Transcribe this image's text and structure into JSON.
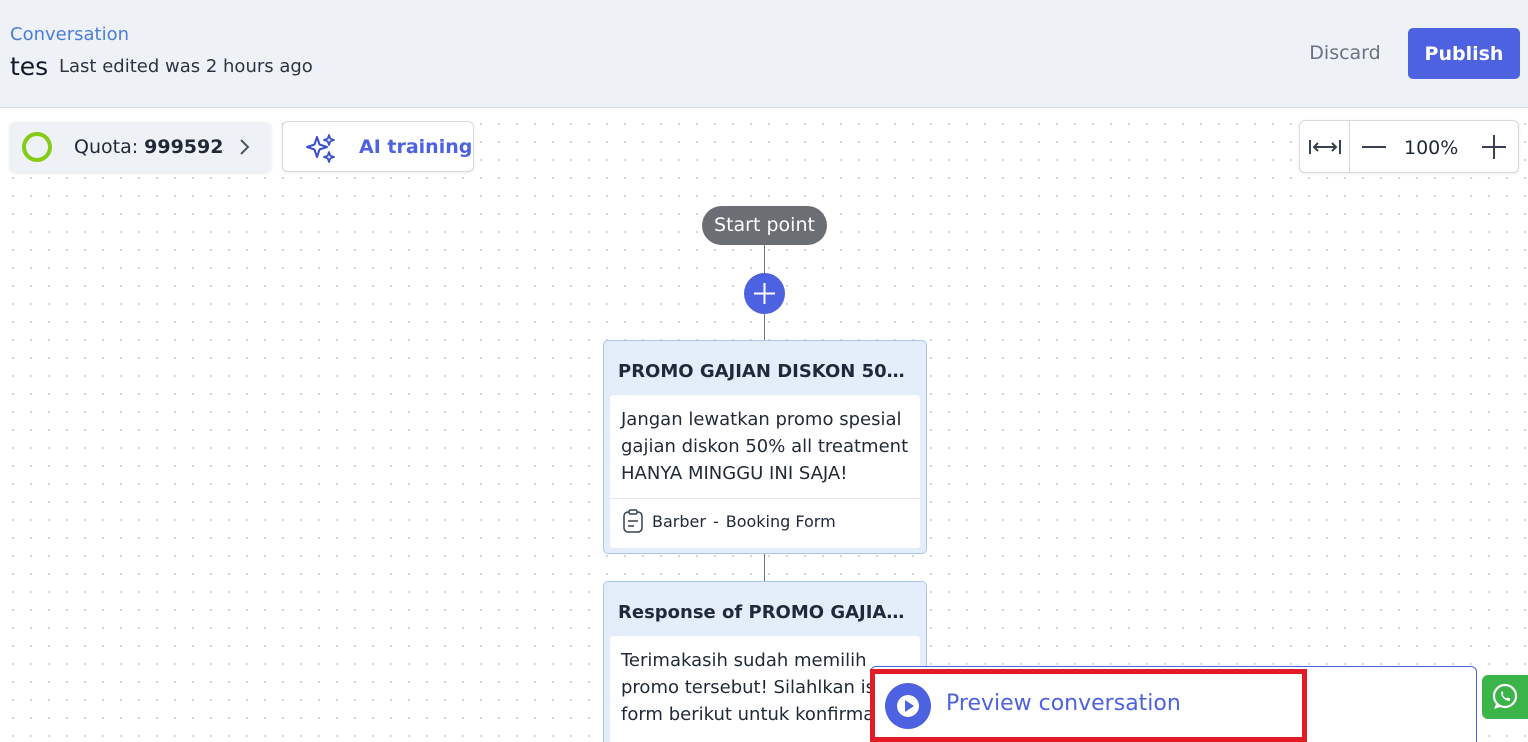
{
  "header": {
    "breadcrumb": "Conversation",
    "flow_name": "tes",
    "last_edited": "Last edited was 2 hours ago",
    "discard_label": "Discard",
    "publish_label": "Publish",
    "accent_color": "#4d62e0"
  },
  "toolbar": {
    "quota_label": "Quota:",
    "quota_value": "999592",
    "ai_training_label": "AI training",
    "zoom_level": "100%"
  },
  "flow": {
    "start_label": "Start point",
    "nodes": [
      {
        "title": "PROMO GAJIAN DISKON 50%...",
        "text_lines": [
          "Jangan lewatkan promo spesial",
          "gajian diskon 50% all treatment",
          "HANYA MINGGU INI SAJA!"
        ],
        "form_name": "Barber",
        "form_separator": "-",
        "form_type": "Booking Form"
      },
      {
        "title": "Response of PROMO GAJIAN ...",
        "text_lines": [
          "Terimakasih sudah memilih",
          "promo tersebut! Silahlkan isi",
          "form berikut untuk konfirmasi"
        ]
      }
    ]
  },
  "preview": {
    "label": "Preview conversation"
  },
  "icons": {
    "quota": "quota-ring-icon",
    "ai": "sparkles-icon",
    "fit": "fit-width-icon",
    "whatsapp": "whatsapp-icon"
  }
}
